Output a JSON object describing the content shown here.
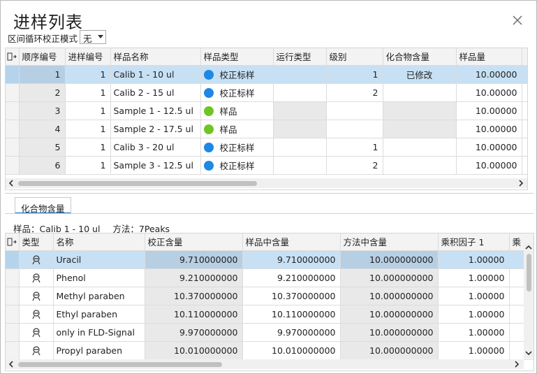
{
  "window": {
    "title": "进样列表"
  },
  "mode": {
    "label": "区间循环校正模式",
    "value": "无"
  },
  "sequence_table": {
    "headers": [
      "顺序编号",
      "进样编号",
      "样品名称",
      "样品类型",
      "运行类型",
      "级别",
      "化合物含量",
      "样品量"
    ],
    "rows": [
      {
        "order": "1",
        "inj": "1",
        "name": "Calib 1 - 10 ul",
        "type": "校正标样",
        "type_color": "#1e88e5",
        "run": "",
        "level": "1",
        "content": "已修改",
        "amount": "10.00000"
      },
      {
        "order": "2",
        "inj": "1",
        "name": "Calib 2 - 15 ul",
        "type": "校正标样",
        "type_color": "#1e88e5",
        "run": "",
        "level": "2",
        "content": "",
        "amount": "10.00000"
      },
      {
        "order": "3",
        "inj": "1",
        "name": "Sample 1 - 12.5 ul",
        "type": "样品",
        "type_color": "#6fc523",
        "run": "",
        "level": "",
        "content": "",
        "amount": "10.00000"
      },
      {
        "order": "4",
        "inj": "1",
        "name": "Sample 2 - 17.5 ul",
        "type": "样品",
        "type_color": "#6fc523",
        "run": "",
        "level": "",
        "content": "",
        "amount": "10.00000"
      },
      {
        "order": "5",
        "inj": "1",
        "name": "Calib 3 - 20 ul",
        "type": "校正标样",
        "type_color": "#1e88e5",
        "run": "",
        "level": "1",
        "content": "",
        "amount": "10.00000"
      },
      {
        "order": "6",
        "inj": "1",
        "name": "Sample 3 - 12.5 ul",
        "type": "校正标样",
        "type_color": "#1e88e5",
        "run": "",
        "level": "2",
        "content": "",
        "amount": "10.00000"
      }
    ]
  },
  "tab": {
    "label": "化合物含量"
  },
  "info": {
    "sample": "样品：Calib 1 - 10 ul",
    "method": "方法：7Peaks"
  },
  "compound_table": {
    "headers": [
      "类型",
      "名称",
      "校正含量",
      "样品中含量",
      "方法中含量",
      "乘积因子 1",
      "乘"
    ],
    "rows": [
      {
        "name": "Uracil",
        "cal": "9.710000000",
        "sample": "9.710000000",
        "method": "10.000000000",
        "factor": "1.00000"
      },
      {
        "name": "Phenol",
        "cal": "9.210000000",
        "sample": "9.210000000",
        "method": "10.000000000",
        "factor": "1.00000"
      },
      {
        "name": "Methyl paraben",
        "cal": "10.370000000",
        "sample": "10.370000000",
        "method": "10.000000000",
        "factor": "1.00000"
      },
      {
        "name": "Ethyl paraben",
        "cal": "10.110000000",
        "sample": "10.110000000",
        "method": "10.000000000",
        "factor": "1.00000"
      },
      {
        "name": "only in FLD-Signal",
        "cal": "9.970000000",
        "sample": "9.970000000",
        "method": "10.000000000",
        "factor": "1.00000"
      },
      {
        "name": "Propyl paraben",
        "cal": "10.010000000",
        "sample": "10.010000000",
        "method": "10.000000000",
        "factor": "1.00000"
      }
    ]
  },
  "icons": {
    "close": "close-icon",
    "column_chooser": "column-chooser-icon",
    "compound": "compound-icon",
    "scroll_left": "chevron-left-icon",
    "scroll_right": "chevron-right-icon",
    "scroll_up": "chevron-up-icon",
    "scroll_down": "chevron-down-icon",
    "dropdown": "chevron-down-icon"
  },
  "colors": {
    "selection": "#c7e0f4",
    "calib": "#1e88e5",
    "sample": "#6fc523",
    "tab_accent": "#1a73d8"
  }
}
